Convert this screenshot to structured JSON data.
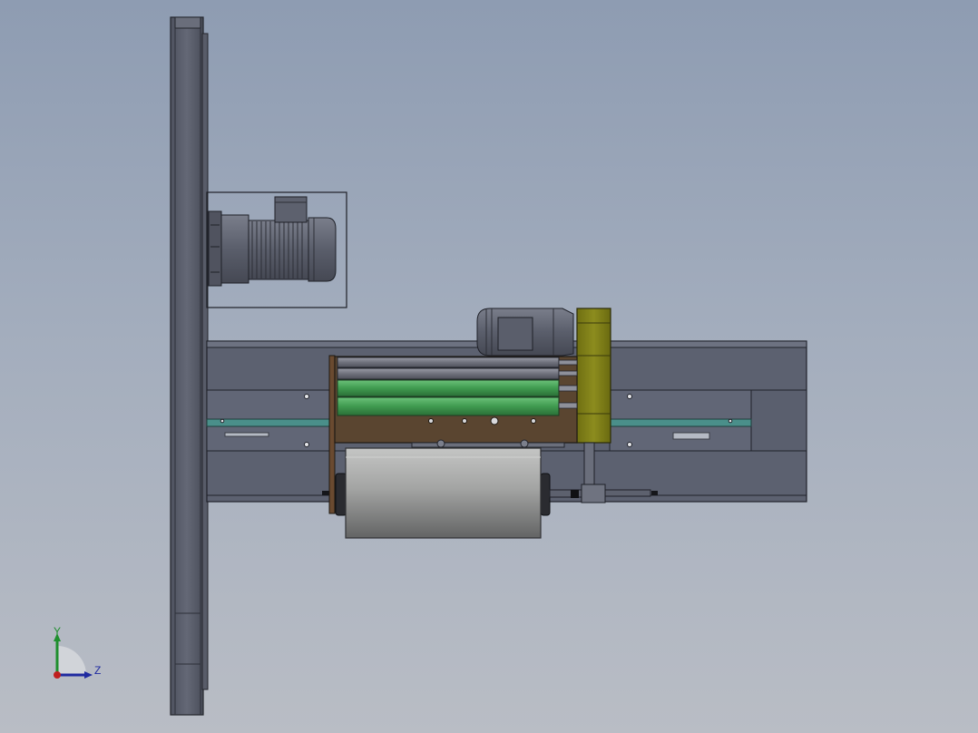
{
  "scene": {
    "background_top": "#8e9cb2",
    "background_bottom": "#b9bdc5",
    "colors": {
      "frame_steel": "#5e6373",
      "frame_edge": "#2a2d36",
      "motor_body": "#5b5f6c",
      "roller_green": "#3f9a4f",
      "roller_gray": "#7d7f8a",
      "brown_plate": "#5a4530",
      "gearbox_olive": "#8c8c1e",
      "conveyor_teal": "#4a8f8a",
      "drum_light": "#a9aaa9",
      "drum_dark": "#6d6e6e"
    }
  },
  "triad": {
    "y_label": "Y",
    "z_label": "Z",
    "y_color": "#1f8f2e",
    "z_color": "#1f2aa0",
    "x_color": "#c01f1f"
  }
}
